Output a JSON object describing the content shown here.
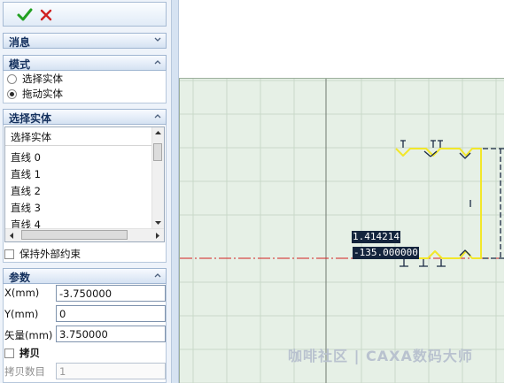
{
  "toolbar": {
    "ok_icon": "checkmark-icon",
    "cancel_icon": "close-icon",
    "ok_color": "#22a022",
    "cancel_color": "#d02020"
  },
  "sections": {
    "message": {
      "title": "消息"
    },
    "mode": {
      "title": "模式",
      "options": [
        {
          "label": "选择实体",
          "selected": false
        },
        {
          "label": "拖动实体",
          "selected": true
        }
      ]
    },
    "select_entity": {
      "title": "选择实体",
      "list_header": "选择实体",
      "items": [
        "直线 0",
        "直线 1",
        "直线 2",
        "直线 3",
        "直线 4"
      ],
      "keep_external_label": "保持外部约束"
    },
    "params": {
      "title": "参数",
      "x_label": "X(mm)",
      "x_value": "-3.750000",
      "y_label": "Y(mm)",
      "y_value": "0",
      "vec_label": "矢量(mm)",
      "vec_value": "3.750000",
      "copy_label": "拷贝",
      "copy_count_label": "拷贝数目",
      "copy_count_value": "1"
    }
  },
  "canvas": {
    "dim_value_1": "1.414214",
    "dim_value_2": "-135.000000",
    "grid_color": "#c9d9c9",
    "shape_color": "#f2e72a",
    "axis_color": "#d42020"
  },
  "watermark": "咖啡社区 | CAXA数码大师"
}
